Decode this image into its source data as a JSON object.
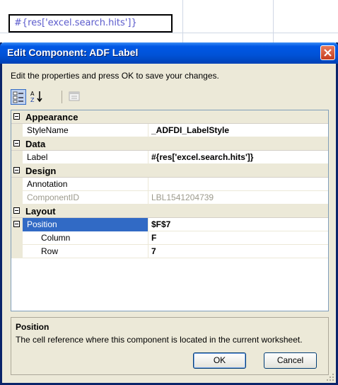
{
  "excel": {
    "cell_text": "#{res['excel.search.hits']}"
  },
  "dialog": {
    "title": "Edit Component: ADF Label",
    "instructions": "Edit the properties and press OK to save your changes.",
    "toolbar": {
      "categorized": "categorized-icon",
      "alphabetical": "sort-az-icon",
      "property_pages": "property-pages-icon"
    },
    "grid": {
      "appearance": {
        "label": "Appearance",
        "stylename_name": "StyleName",
        "stylename_value": "_ADFDI_LabelStyle"
      },
      "data": {
        "label": "Data",
        "label_name": "Label",
        "label_value": "#{res['excel.search.hits']}"
      },
      "design": {
        "label": "Design",
        "annotation_name": "Annotation",
        "annotation_value": "",
        "componentid_name": "ComponentID",
        "componentid_value": "LBL1541204739"
      },
      "layout": {
        "label": "Layout",
        "position_name": "Position",
        "position_value": "$F$7",
        "column_name": "Column",
        "column_value": "F",
        "row_name": "Row",
        "row_value": "7"
      }
    },
    "description": {
      "title": "Position",
      "text": "The cell reference where this component is located in the current worksheet."
    },
    "buttons": {
      "ok": "OK",
      "cancel": "Cancel"
    }
  },
  "colors": {
    "title_bar": "#0054e3",
    "selection": "#316ac5",
    "dialog_face": "#ece9d8"
  }
}
